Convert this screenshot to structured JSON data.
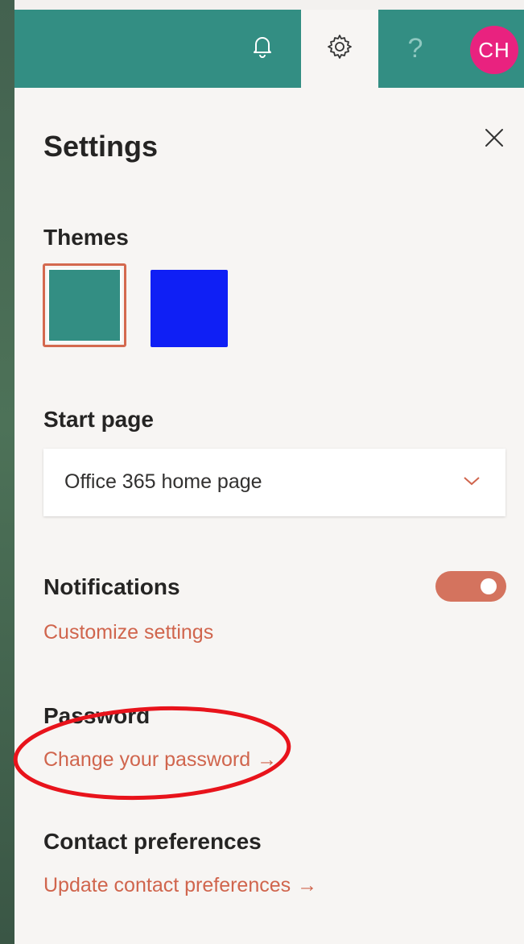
{
  "header": {
    "bell_icon": "bell-icon",
    "gear_icon": "gear-icon",
    "help_label": "?",
    "avatar_initials": "CH",
    "avatar_color": "#e9227f",
    "bar_color": "#338e83"
  },
  "panel": {
    "title": "Settings",
    "close_icon": "close-icon",
    "themes": {
      "heading": "Themes",
      "options": [
        {
          "name": "teal",
          "color": "#338e83",
          "selected": true
        },
        {
          "name": "blue",
          "color": "#0f1ff5",
          "selected": false
        }
      ]
    },
    "start_page": {
      "heading": "Start page",
      "selected": "Office 365 home page"
    },
    "notifications": {
      "heading": "Notifications",
      "enabled": true,
      "link": "Customize settings"
    },
    "password": {
      "heading": "Password",
      "link": "Change your password",
      "arrow": "→"
    },
    "contact": {
      "heading": "Contact preferences",
      "link": "Update contact preferences",
      "arrow": "→"
    }
  },
  "accent_color": "#d0654d",
  "annotation_color": "#e8131b"
}
